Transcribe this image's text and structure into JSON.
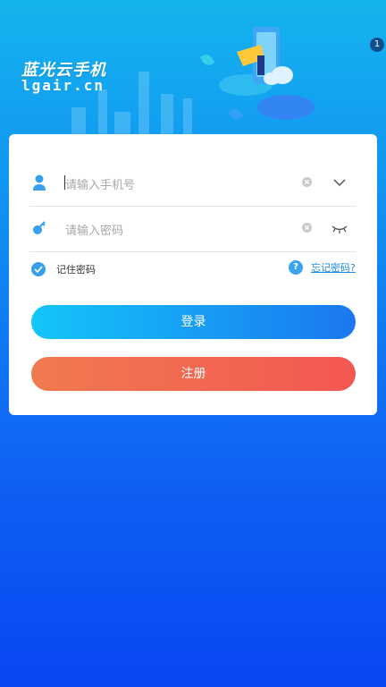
{
  "app": {
    "name": "蓝光云手机",
    "domain": "lgair.cn",
    "badge": "1"
  },
  "login_form": {
    "phone_placeholder": "请输入手机号",
    "password_placeholder": "请输入密码",
    "remember_label": "记住密码",
    "remember_checked": true,
    "forgot_link": "忘记密码?",
    "help_icon_text": "?",
    "login_button": "登录",
    "register_button": "注册"
  },
  "colors": {
    "bg_top": "#15b4ee",
    "bg_bottom": "#0a46f2",
    "login_gradient": [
      "#14c6f9",
      "#1a77f0"
    ],
    "register_gradient": [
      "#f07a4f",
      "#f35752"
    ],
    "accent": "#37a0ee"
  },
  "icons": {
    "phone_field": "user-icon",
    "password_field": "key-icon",
    "clear": "clear-icon",
    "dropdown": "chevron-down-icon",
    "visibility": "eye-closed-icon",
    "remember": "check-icon",
    "forgot": "help-icon"
  }
}
